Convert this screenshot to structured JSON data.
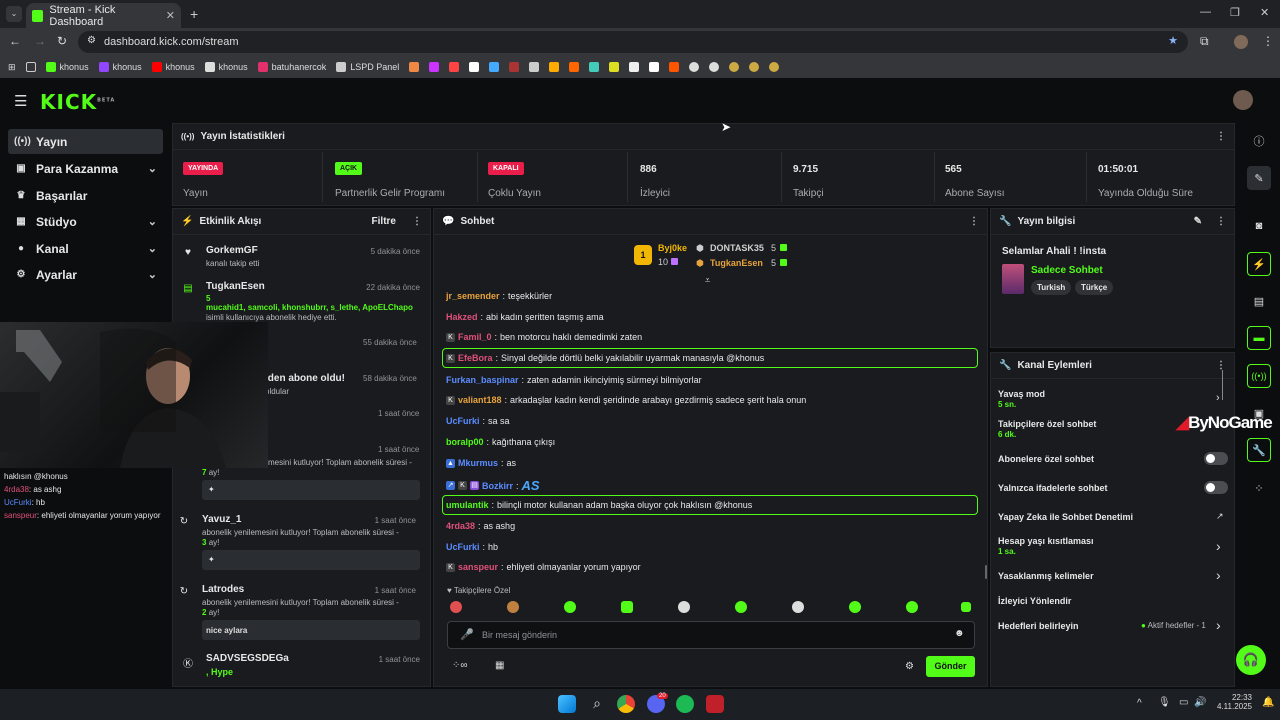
{
  "browser": {
    "tab_title": "Stream - Kick Dashboard",
    "url": "dashboard.kick.com/stream",
    "bookmarks": [
      {
        "label": "",
        "icon": "folder-icon"
      },
      {
        "label": "khonus",
        "icon": "kick-icon",
        "color": "#53fc18"
      },
      {
        "label": "khonus",
        "icon": "twitch-icon",
        "color": "#9146ff"
      },
      {
        "label": "khonus",
        "icon": "youtube-icon",
        "color": "#ff0000"
      },
      {
        "label": "khonus",
        "icon": "x-icon",
        "color": "#dddddd"
      },
      {
        "label": "batuhanercok",
        "icon": "instagram-icon",
        "color": "#e1306c"
      },
      {
        "label": "LSPD Panel",
        "icon": "lspd-icon",
        "color": "#cccccc"
      }
    ]
  },
  "header": {
    "logo": "KICK",
    "logo_sup": "BETA"
  },
  "sidebar": {
    "items": [
      {
        "label": "Yayın",
        "icon": "broadcast-icon",
        "active": true
      },
      {
        "label": "Para Kazanma",
        "icon": "money-icon",
        "chevron": true
      },
      {
        "label": "Başarılar",
        "icon": "trophy-icon"
      },
      {
        "label": "Stüdyo",
        "icon": "studio-icon",
        "chevron": true
      },
      {
        "label": "Kanal",
        "icon": "user-icon",
        "chevron": true
      },
      {
        "label": "Ayarlar",
        "icon": "gear-icon",
        "chevron": true
      }
    ]
  },
  "stats": {
    "title": "Yayın İstatistikleri",
    "cells": [
      {
        "badge": "YAYINDA",
        "label": "Yayın",
        "badge_color": "#e91e4a"
      },
      {
        "badge": "AÇIK",
        "label": "Partnerlik Gelir Programı",
        "badge_color": "#53fc18"
      },
      {
        "badge": "KAPALI",
        "label": "Çoklu Yayın",
        "badge_color": "#e91e4a"
      },
      {
        "value": "886",
        "label": "İzleyici"
      },
      {
        "value": "9.715",
        "label": "Takipçi"
      },
      {
        "value": "565",
        "label": "Abone Sayısı"
      },
      {
        "value": "01:50:01",
        "label": "Yayında Olduğu Süre"
      }
    ]
  },
  "activity": {
    "title": "Etkinlik Akışı",
    "filter": "Filtre",
    "items": [
      {
        "name": "GorkemGF",
        "time": "5 dakika önce",
        "text": "kanalı takip etti"
      },
      {
        "name": "TugkanEsen",
        "time": "22 dakika önce",
        "count": "5",
        "gifted": "mucahid1, samcoli, khonshubrr, s_lethe, ApoELChapo",
        "text": "isimli kullanıcıya abonelik hediye etti."
      },
      {
        "time": "55 dakika önce"
      },
      {
        "text": "iden abone oldu!",
        "time": "58 dakika önce",
        "sub": "oldular"
      },
      {
        "time": "1 saat önce"
      },
      {
        "time": "1 saat önce",
        "text": "mesini kutluyor! Toplam abonelik süresi -",
        "months": "7",
        "months_suffix": "ay!",
        "box": ""
      },
      {
        "name": "Yavuz_1",
        "time": "1 saat önce",
        "text": "abonelik yenilemesini kutluyor! Toplam abonelik süresi -",
        "months": "3",
        "months_suffix": "ay!",
        "box": ""
      },
      {
        "name": "Latrodes",
        "time": "1 saat önce",
        "text": "abonelik yenilemesini kutluyor! Toplam abonelik süresi -",
        "months": "2",
        "months_suffix": "ay!",
        "box": "nice aylara"
      },
      {
        "name": "SADVSEGSDEGa",
        "time": "1 saat önce",
        "text": ", Hype"
      }
    ]
  },
  "chat": {
    "title": "Sohbet",
    "leaderboard": {
      "first": {
        "rank": "1",
        "name": "Byj0ke",
        "count": "10"
      },
      "second": {
        "name": "DONTASK35",
        "count": "5"
      },
      "third": {
        "name": "TugkanEsen",
        "count": "5"
      }
    },
    "messages": [
      {
        "user": "jr_semender",
        "color": "#e8a33d",
        "text": "teşekkürler"
      },
      {
        "user": "Hakzed",
        "color": "#e0507a",
        "text": "abi kadın şeritten taşmış ama"
      },
      {
        "user": "Famil_0",
        "color": "#e0507a",
        "text": "ben motorcu haklı demedimki zaten",
        "badge": true
      },
      {
        "user": "EfeBora",
        "color": "#e0507a",
        "text": "Sinyal değilde dörtlü belki yakılabilir uyarmak manasıyla @khonus",
        "badge": true,
        "highlight": true
      },
      {
        "user": "Furkan_baspinar",
        "color": "#5b8cff",
        "text": "zaten adamin ikinciyimiş sürmeyi bilmiyorlar"
      },
      {
        "user": "valiant188",
        "color": "#e8a33d",
        "text": "arkadaşlar kadın kendi şeridinde arabayı gezdirmiş sadece şerit hala onun",
        "badge": true
      },
      {
        "user": "UcFurki",
        "color": "#5b8cff",
        "text": "sa sa"
      },
      {
        "user": "boralp00",
        "color": "#53fc18",
        "text": "kağıthana çıkışı"
      },
      {
        "user": "Mkurmus",
        "color": "#5b8cff",
        "text": "as",
        "badge": true
      },
      {
        "user": "Bozkirr",
        "color": "#5b8cff",
        "text": "AS",
        "badge": true,
        "big": true
      },
      {
        "user": "umulantik",
        "color": "#53fc18",
        "text": "bilinçli motor kullanan adam başka oluyor çok haklısın @khonus",
        "highlight": true
      },
      {
        "user": "4rda38",
        "color": "#e0507a",
        "text": "as ashg"
      },
      {
        "user": "UcFurki",
        "color": "#5b8cff",
        "text": "hb"
      },
      {
        "user": "sanspeur",
        "color": "#e0507a",
        "text": "ehliyeti olmayanlar yorum yapıyor",
        "badge": true
      }
    ],
    "followers_only": "Takipçilere Özel",
    "input_placeholder": "Bir mesaj gönderin",
    "send": "Gönder"
  },
  "stream_info": {
    "title": "Yayın bilgisi",
    "stream_title": "Selamlar Ahali ! !insta",
    "category": "Sadece Sohbet",
    "tags": [
      "Turkish",
      "Türkçe"
    ]
  },
  "channel_actions": {
    "title": "Kanal Eylemleri",
    "items": [
      {
        "label": "Yavaş mod",
        "sub": "5 sn.",
        "control": "chevron"
      },
      {
        "label": "Takipçilere özel sohbet",
        "sub": "6 dk.",
        "control": "chevron"
      },
      {
        "label": "Abonelere özel sohbet",
        "control": "toggle",
        "on": false
      },
      {
        "label": "Yalnızca ifadelerle sohbet",
        "control": "toggle",
        "on": false
      },
      {
        "label": "Yapay Zeka ile Sohbet Denetimi",
        "control": "external"
      },
      {
        "label": "Hesap yaşı kısıtlaması",
        "sub": "1 sa.",
        "control": "chevron"
      },
      {
        "label": "Yasaklanmış kelimeler",
        "control": "chevron"
      },
      {
        "label": "İzleyici Yönlendir"
      },
      {
        "label": "Hedefleri belirleyin",
        "status": "Aktif hedefler - 1",
        "control": "chevron"
      }
    ]
  },
  "overlay": {
    "watermark": "ByNoGame",
    "cam_chat": [
      {
        "user": "",
        "text": "haklısın @khonus"
      },
      {
        "user": "4rda38",
        "text": "as ashg"
      },
      {
        "user": "UcFurki",
        "text": "hb"
      },
      {
        "user": "sanspeur",
        "text": "ehliyeti olmayanlar yorum yapıyor"
      }
    ]
  },
  "taskbar": {
    "time": "22:33",
    "date": "4.11.2025",
    "badge": "20"
  }
}
